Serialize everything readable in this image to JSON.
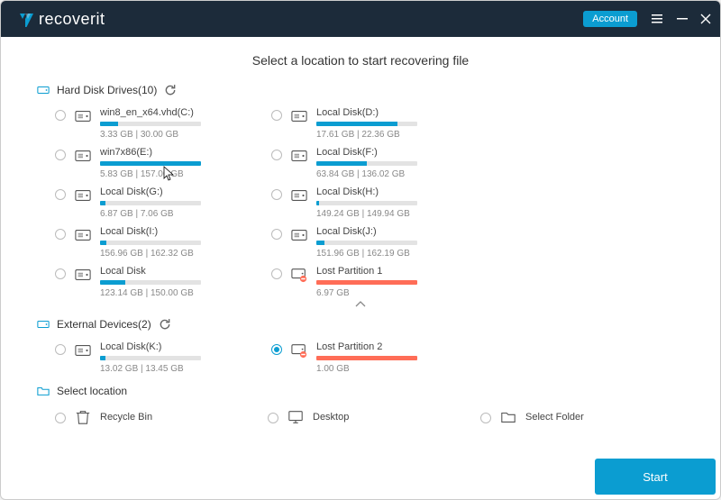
{
  "header": {
    "brand": "recoverit",
    "account_label": "Account"
  },
  "page_title": "Select a location to start recovering file",
  "sections": {
    "hdd": {
      "label": "Hard Disk Drives(10)"
    },
    "ext": {
      "label": "External Devices(2)"
    },
    "sel": {
      "label": "Select location"
    }
  },
  "hdd": [
    {
      "name": "win8_en_x64.vhd(C:)",
      "size": "3.33  GB | 30.00  GB",
      "type": "blue",
      "fill": 18
    },
    {
      "name": "Local Disk(D:)",
      "size": "17.61  GB | 22.36  GB",
      "type": "blue",
      "fill": 80
    },
    {
      "name": "win7x86(E:)",
      "size": "5.83  GB | 157.00  GB",
      "type": "blue",
      "fill": 100
    },
    {
      "name": "Local Disk(F:)",
      "size": "63.84  GB | 136.02  GB",
      "type": "blue",
      "fill": 50
    },
    {
      "name": "Local Disk(G:)",
      "size": "6.87  GB | 7.06  GB",
      "type": "blue",
      "fill": 5
    },
    {
      "name": "Local Disk(H:)",
      "size": "149.24  GB | 149.94  GB",
      "type": "blue",
      "fill": 3
    },
    {
      "name": "Local Disk(I:)",
      "size": "156.96  GB | 162.32  GB",
      "type": "blue",
      "fill": 6
    },
    {
      "name": "Local Disk(J:)",
      "size": "151.96  GB | 162.19  GB",
      "type": "blue",
      "fill": 8
    },
    {
      "name": "Local Disk",
      "size": "123.14  GB | 150.00  GB",
      "type": "blue",
      "fill": 25
    },
    {
      "name": "Lost Partition 1",
      "size": "6.97  GB",
      "type": "red",
      "fill": 100
    }
  ],
  "ext": [
    {
      "name": "Local Disk(K:)",
      "size": "13.02  GB | 13.45  GB",
      "type": "blue",
      "fill": 5,
      "selected": false,
      "icon": "disk"
    },
    {
      "name": "Lost Partition 2",
      "size": "1.00  GB",
      "type": "red",
      "fill": 100,
      "selected": true,
      "icon": "lost"
    }
  ],
  "locations": [
    {
      "name": "Recycle Bin",
      "icon": "bin"
    },
    {
      "name": "Desktop",
      "icon": "desktop"
    },
    {
      "name": "Select Folder",
      "icon": "folder"
    }
  ],
  "footer": {
    "start_label": "Start"
  }
}
